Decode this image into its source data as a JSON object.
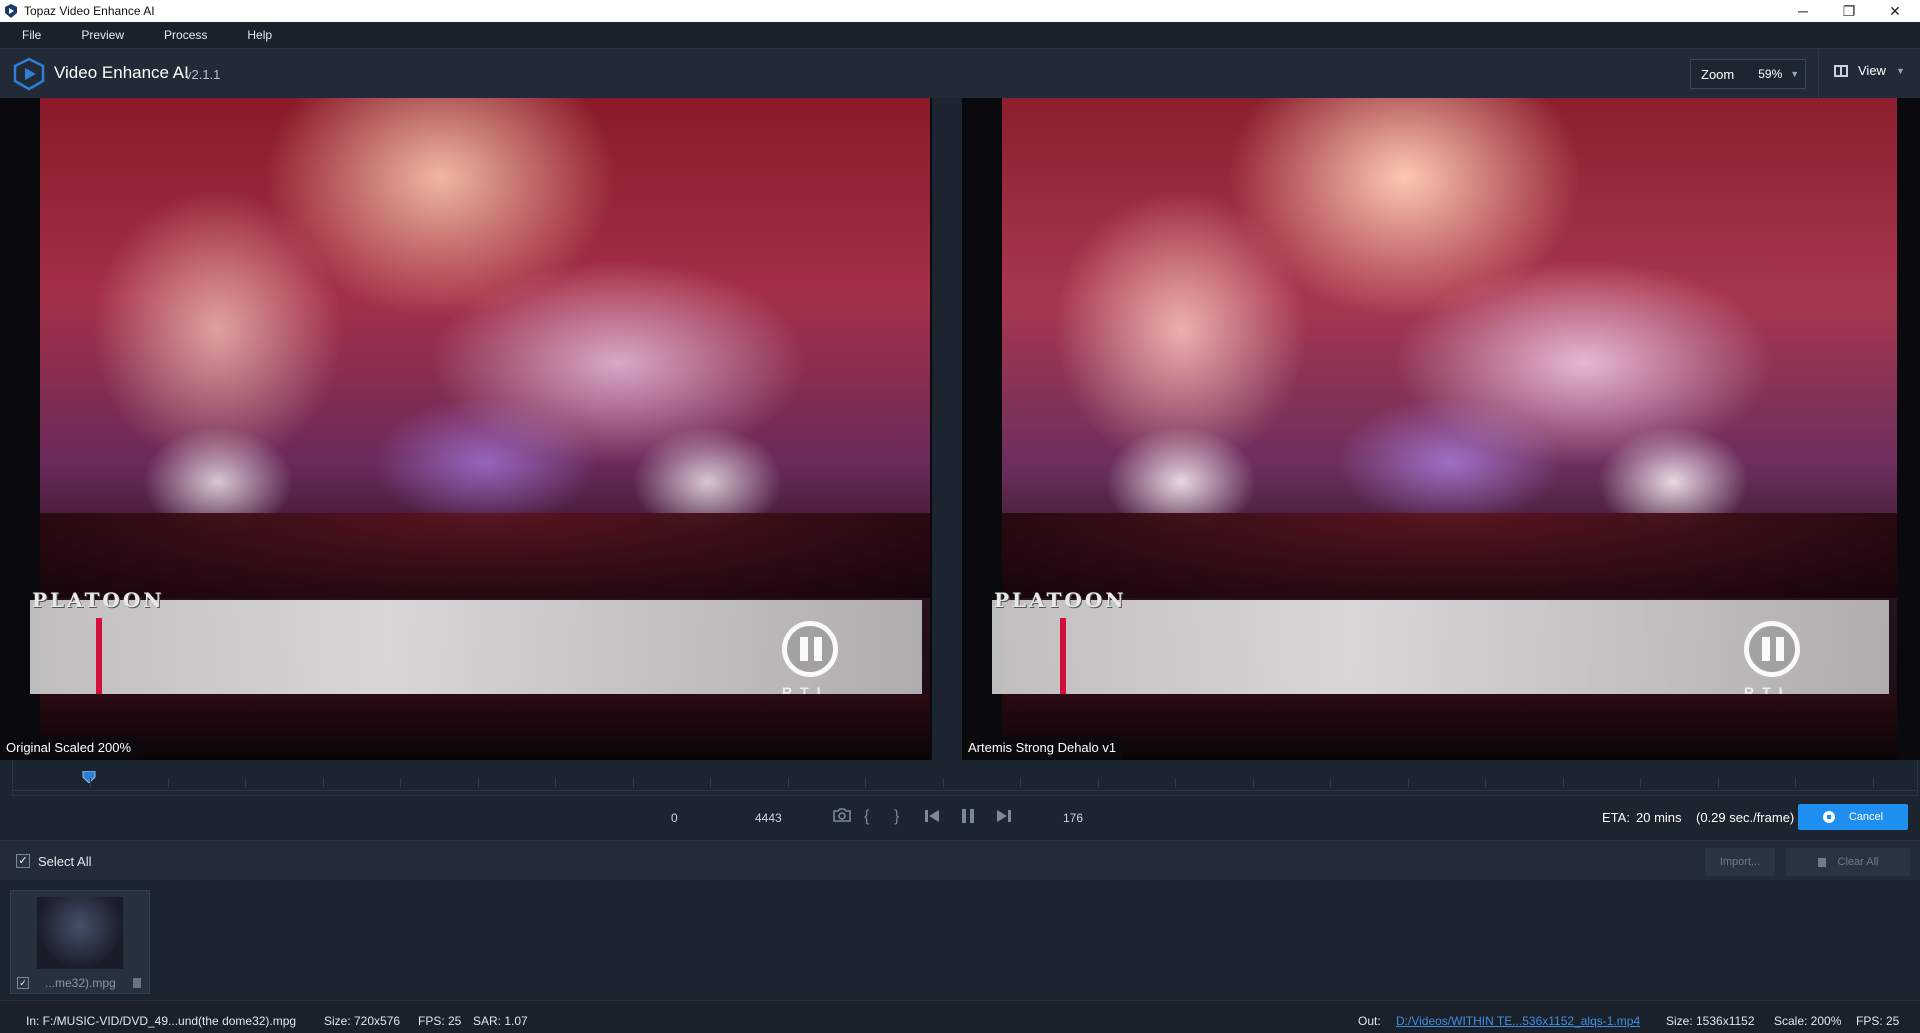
{
  "window": {
    "title": "Topaz Video Enhance AI",
    "controls": [
      "─",
      "❐",
      "✕"
    ]
  },
  "menu": {
    "items": [
      "File",
      "Preview",
      "Process",
      "Help"
    ]
  },
  "header": {
    "app_name": "Video Enhance AI",
    "version": "v2.1.1",
    "zoom_label": "Zoom",
    "zoom_value": "59%",
    "view_label": "View"
  },
  "preview": {
    "left_label": "Original Scaled 200%",
    "right_label": "Artemis Strong Dehalo v1",
    "banner_text": "PLATOON",
    "channel_text": "RTL"
  },
  "timeline": {
    "start_frame": "0",
    "end_frame": "4443",
    "current_frame": "176",
    "progress_fraction": 0.04,
    "eta_label": "ETA:",
    "eta_value": "20 mins",
    "eta_rate": "(0.29 sec./frame)",
    "cancel_label": "Cancel"
  },
  "files": {
    "select_all_label": "Select All",
    "select_all_checked": true,
    "import_label": "Import...",
    "clear_all_label": "Clear All",
    "items": [
      {
        "name": "...me32).mpg",
        "checked": true
      }
    ]
  },
  "status": {
    "in_path": "In: F:/MUSIC-VID/DVD_49...und(the dome32).mpg",
    "in_size": "Size: 720x576",
    "in_fps": "FPS: 25",
    "in_sar": "SAR: 1.07",
    "out_label": "Out:",
    "out_path": "D:/Videos/WITHIN TE...536x1152_alqs-1.mp4",
    "out_size": "Size: 1536x1152",
    "out_scale": "Scale: 200%",
    "out_fps": "FPS: 25"
  },
  "colors": {
    "accent": "#1f8ef1",
    "background": "#1c2430",
    "link": "#3d8fe0"
  }
}
